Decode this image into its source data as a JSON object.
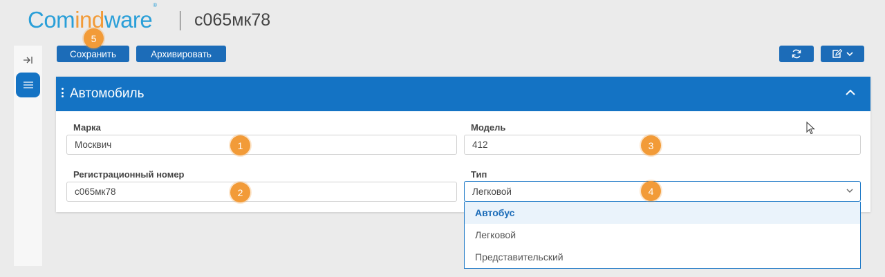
{
  "app": {
    "logo": {
      "part1": "Com",
      "part2": "ind",
      "part3": "ware",
      "mark": "®"
    },
    "record_title": "c065мк78"
  },
  "toolbar": {
    "save_label": "Сохранить",
    "archive_label": "Архивировать",
    "refresh_icon": "refresh-icon",
    "edit_icon": "edit-menu-icon"
  },
  "sidebar": {
    "collapse_icon": "collapse-icon",
    "menu_icon": "menu-icon"
  },
  "panel": {
    "title": "Автомобиль",
    "fields": {
      "brand": {
        "label": "Марка",
        "value": "Москвич"
      },
      "model": {
        "label": "Модель",
        "value": "412"
      },
      "reg_number": {
        "label": "Регистрационный номер",
        "value": "c065мк78"
      },
      "type": {
        "label": "Тип",
        "value": "Легковой"
      }
    },
    "type_options": [
      "Автобус",
      "Легковой",
      "Представительский"
    ]
  },
  "badges": [
    "1",
    "2",
    "3",
    "4",
    "5"
  ],
  "colors": {
    "accent": "#1473c4",
    "badge": "#f29b38",
    "logo_blue": "#2a9fd8"
  }
}
